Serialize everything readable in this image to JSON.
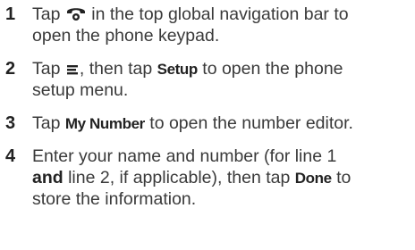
{
  "steps": [
    {
      "number": "1",
      "line1_before_icon": "Tap",
      "icon": "phone-handset-icon",
      "line1_after_icon": "in the top global navigation bar to",
      "line2": "open the phone keypad."
    },
    {
      "number": "2",
      "line1_before_icon": "Tap",
      "icon": "menu-icon",
      "line1_mid": ", then tap",
      "keyword": "Setup",
      "line1_after": "to open the phone",
      "line2": "setup menu."
    },
    {
      "number": "3",
      "line1_before": "Tap",
      "keyword": "My Number",
      "line1_after": "to open the number editor."
    },
    {
      "number": "4",
      "line1": "Enter your name and number (for line 1",
      "line2_bold": "and",
      "line2_mid": "line 2, if applicable), then tap",
      "line2_keyword": "Done",
      "line2_after": "to",
      "line3": "store the information."
    }
  ]
}
